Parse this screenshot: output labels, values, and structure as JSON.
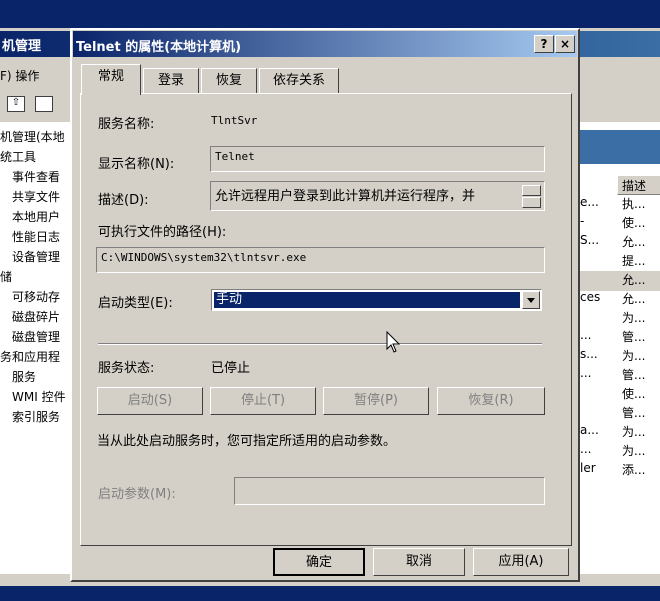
{
  "background_window": {
    "title": "机管理",
    "menu": [
      "F) 操作"
    ],
    "tree": [
      "机管理(本地",
      "统工具",
      "事件查看",
      "共享文件",
      "本地用户",
      "性能日志",
      "设备管理",
      "储",
      "可移动存",
      "磁盘碎片",
      "磁盘管理",
      "务和应用程",
      "服务",
      "WMI 控件",
      "索引服务"
    ],
    "list_header": "描述",
    "list_rows": [
      {
        "c1": "e...",
        "c2": "执..."
      },
      {
        "c1": "-",
        "c2": "使..."
      },
      {
        "c1": "S...",
        "c2": "允..."
      },
      {
        "c1": "",
        "c2": "提..."
      },
      {
        "c1": "",
        "c2": "允..."
      },
      {
        "c1": "ces",
        "c2": "允..."
      },
      {
        "c1": "",
        "c2": "为..."
      },
      {
        "c1": "...",
        "c2": "管..."
      },
      {
        "c1": "s...",
        "c2": "为..."
      },
      {
        "c1": "...",
        "c2": "管..."
      },
      {
        "c1": "",
        "c2": "使..."
      },
      {
        "c1": "",
        "c2": "管..."
      },
      {
        "c1": "a...",
        "c2": "为..."
      },
      {
        "c1": "...",
        "c2": "为..."
      },
      {
        "c1": "ler",
        "c2": "添..."
      }
    ]
  },
  "dialog": {
    "title": "Telnet 的属性(本地计算机)",
    "help_btn": "?",
    "close_btn": "×",
    "tabs": [
      "常规",
      "登录",
      "恢复",
      "依存关系"
    ],
    "service_name_label": "服务名称:",
    "service_name_value": "TlntSvr",
    "display_name_label": "显示名称(N):",
    "display_name_value": "Telnet",
    "description_label": "描述(D):",
    "description_value": "允许远程用户登录到此计算机并运行程序，并",
    "path_label": "可执行文件的路径(H):",
    "path_value": "C:\\WINDOWS\\system32\\tlntsvr.exe",
    "startup_type_label": "启动类型(E):",
    "startup_type_value": "手动",
    "status_label": "服务状态:",
    "status_value": "已停止",
    "btn_start": "启动(S)",
    "btn_stop": "停止(T)",
    "btn_pause": "暂停(P)",
    "btn_resume": "恢复(R)",
    "hint": "当从此处启动服务时，您可指定所适用的启动参数。",
    "params_label": "启动参数(M):",
    "params_value": "",
    "ok": "确定",
    "cancel": "取消",
    "apply": "应用(A)"
  }
}
